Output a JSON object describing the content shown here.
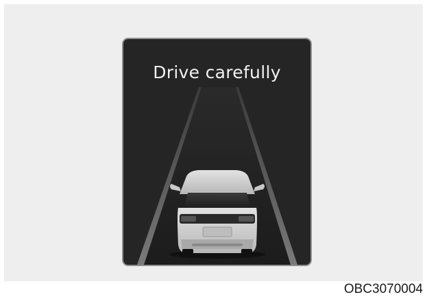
{
  "display": {
    "message": "Drive carefully"
  },
  "figure": {
    "code": "OBC3070004"
  },
  "colors": {
    "screen_background": "#252525",
    "screen_border": "#8e8e8e",
    "lane_line": "#6a6a6a",
    "car_body": "#d0d0d0",
    "page_background": "#eeeeee"
  },
  "icons": {
    "scene": "car-rear-view-on-road-icon"
  }
}
